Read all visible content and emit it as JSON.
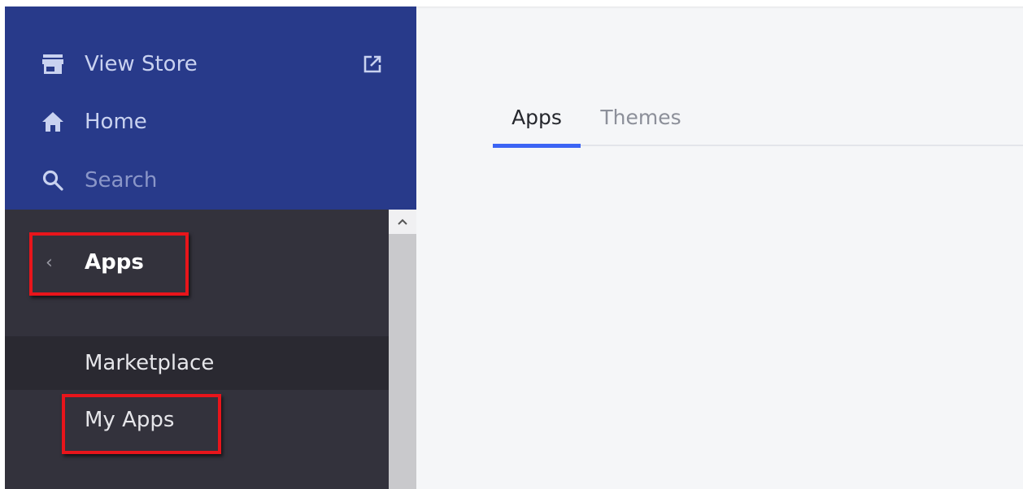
{
  "sidebar": {
    "view_store": {
      "label": "View Store",
      "icon": "store-icon",
      "ext_icon": "external-link-icon"
    },
    "home": {
      "label": "Home",
      "icon": "home-icon"
    },
    "search": {
      "placeholder": "Search",
      "icon": "search-icon"
    },
    "section": {
      "title": "Apps",
      "back_icon": "chevron-left-icon"
    },
    "items": [
      {
        "label": "Marketplace",
        "active": true
      },
      {
        "label": "My Apps",
        "active": false
      }
    ]
  },
  "main": {
    "tabs": [
      {
        "label": "Apps",
        "active": true
      },
      {
        "label": "Themes",
        "active": false
      }
    ]
  },
  "colors": {
    "sidebar_top": "#283a8a",
    "sidebar_bottom": "#33323c",
    "accent": "#3c64f4",
    "highlight": "#e8151b"
  }
}
